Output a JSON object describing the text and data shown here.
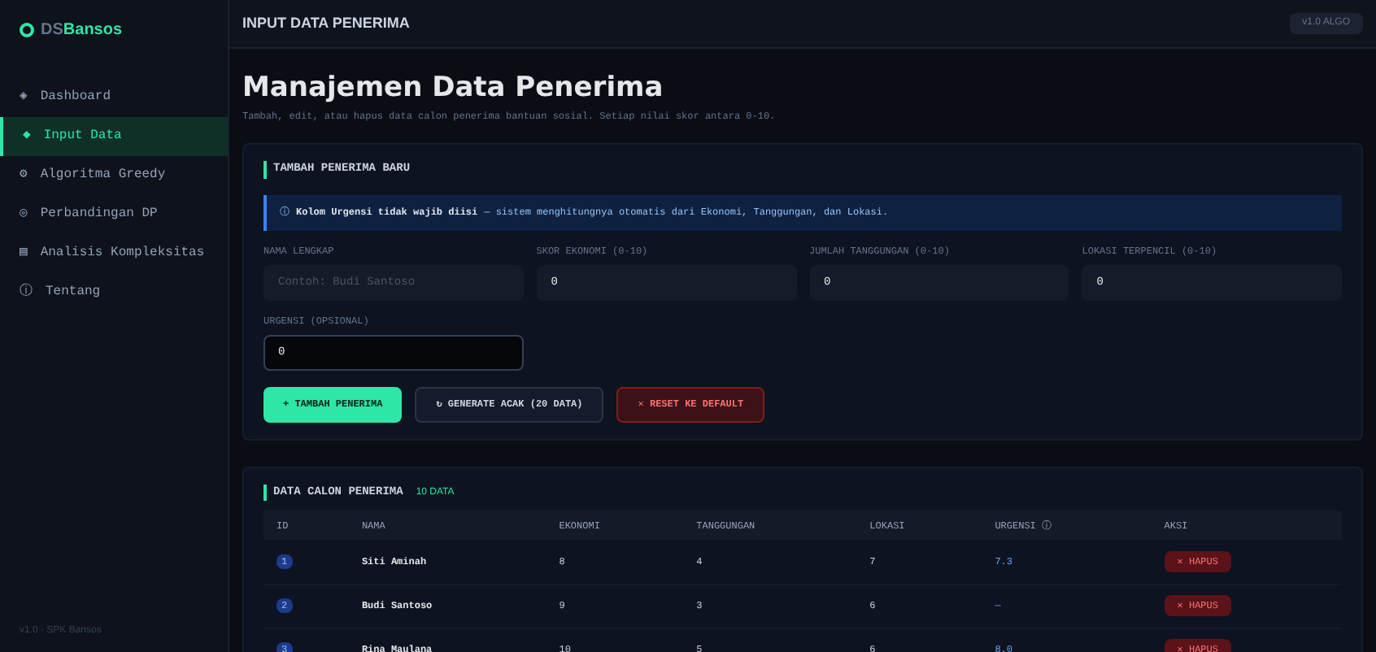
{
  "brand": {
    "prefix": "DS",
    "accent": "Bansos"
  },
  "sidebar": {
    "items": [
      {
        "icon": "◈",
        "label": "Dashboard",
        "selected": false
      },
      {
        "icon": "◆",
        "label": "Input Data",
        "selected": true
      },
      {
        "icon": "⚙",
        "label": "Algoritma Greedy",
        "selected": false
      },
      {
        "icon": "◎",
        "label": "Perbandingan DP",
        "selected": false
      },
      {
        "icon": "▤",
        "label": "Analisis Kompleksitas",
        "selected": false
      },
      {
        "icon": "ⓘ",
        "label": "Tentang",
        "selected": false
      }
    ],
    "footer": "v1.0 · SPK Bansos"
  },
  "header": {
    "title": "INPUT DATA PENERIMA",
    "badge": "v1.0 ALGO"
  },
  "page": {
    "title": "Manajemen Data Penerima",
    "subtitle": "Tambah, edit, atau hapus data calon penerima bantuan sosial. Setiap nilai skor antara 0-10."
  },
  "form": {
    "title": "TAMBAH PENERIMA BARU",
    "info_icon": "ⓘ",
    "info_bold": "Kolom Urgensi tidak wajib diisi",
    "info_text": " — sistem menghitungnya otomatis dari Ekonomi, Tanggungan, dan Lokasi.",
    "fields": [
      {
        "label": "NAMA LENGKAP",
        "placeholder": "Contoh: Budi Santoso"
      },
      {
        "label": "SKOR EKONOMI (0-10)",
        "value": "0"
      },
      {
        "label": "JUMLAH TANGGUNGAN (0-10)",
        "value": "0"
      },
      {
        "label": "LOKASI TERPENCIL (0-10)",
        "value": "0"
      },
      {
        "label": "URGENSI (OPSIONAL)",
        "value": "0"
      }
    ],
    "buttons": [
      {
        "kind": "primary",
        "label": "+ TAMBAH PENERIMA"
      },
      {
        "kind": "secondary",
        "label": "↻ GENERATE ACAK (20 DATA)"
      },
      {
        "kind": "danger",
        "label": "✕ RESET KE DEFAULT"
      }
    ]
  },
  "table": {
    "title": "DATA CALON PENERIMA",
    "badge": "10 DATA",
    "columns": [
      "ID",
      "NAMA",
      "EKONOMI",
      "TANGGUNGAN",
      "LOKASI",
      "URGENSI ⓘ",
      "AKSI"
    ],
    "rows": [
      {
        "cells": [
          "1",
          "Siti Aminah",
          "8",
          "4",
          "7",
          "7.3"
        ],
        "action": "✕ HAPUS"
      },
      {
        "cells": [
          "2",
          "Budi Santoso",
          "9",
          "3",
          "6",
          "—"
        ],
        "action": "✕ HAPUS"
      },
      {
        "cells": [
          "3",
          "Rina Maulana",
          "10",
          "5",
          "6",
          "8.0"
        ],
        "action": "✕ HAPUS"
      }
    ]
  }
}
